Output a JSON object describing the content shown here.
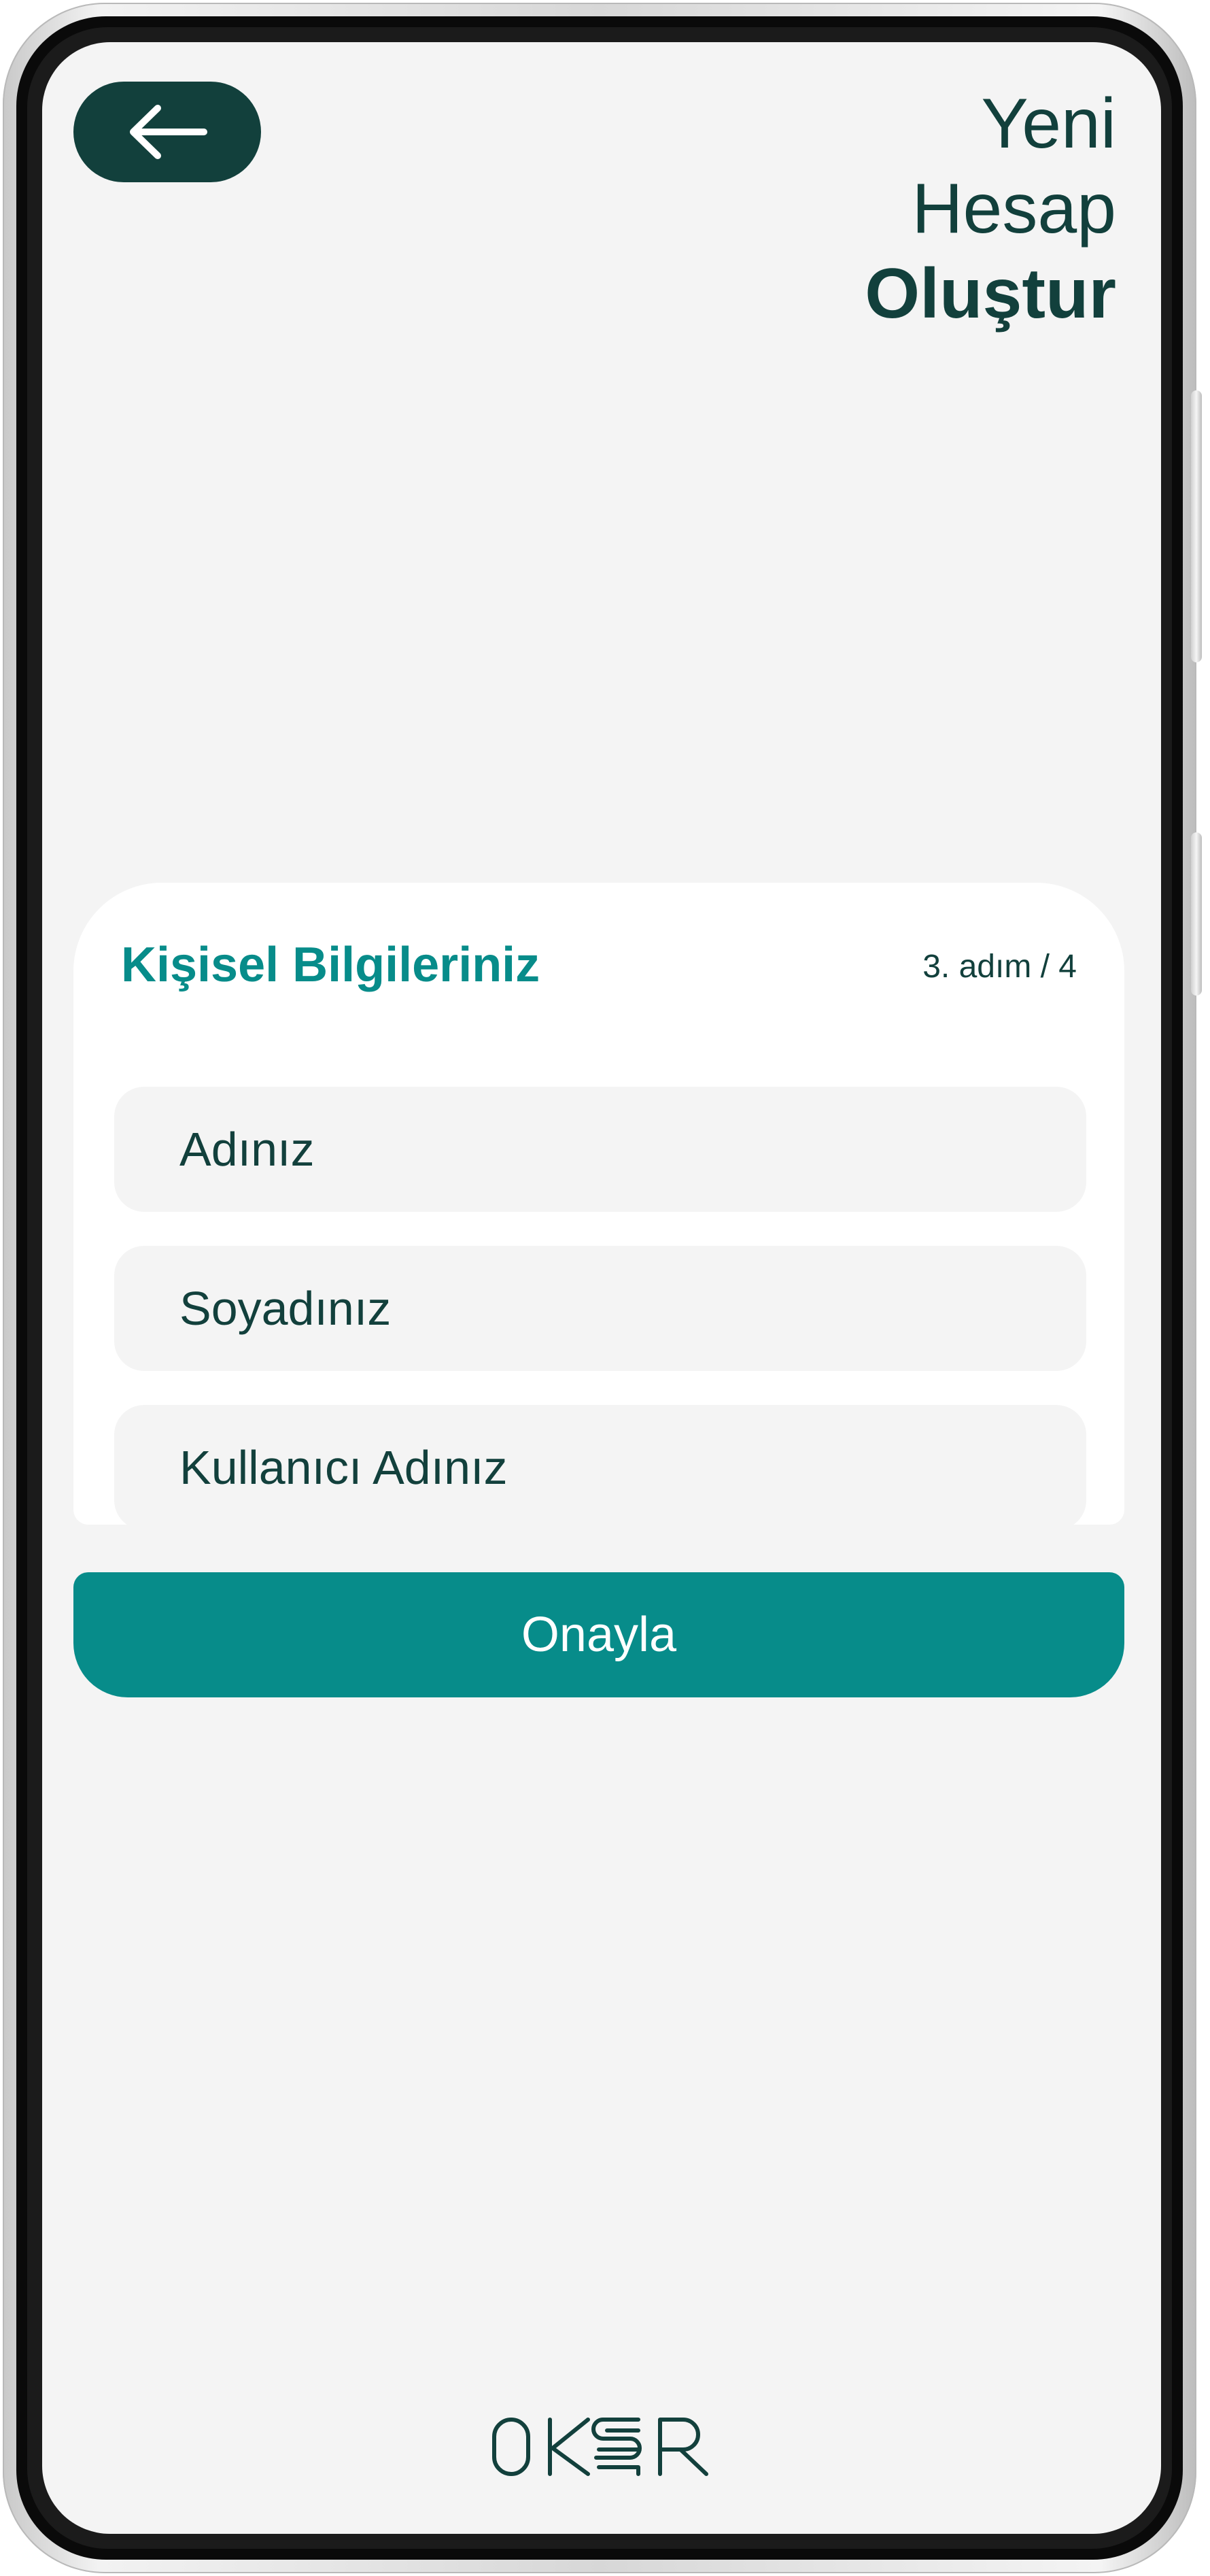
{
  "header": {
    "back_icon": "arrow-left-icon",
    "title_line1": "Yeni",
    "title_line2": "Hesap",
    "title_line3": "Oluştur"
  },
  "form": {
    "heading": "Kişisel Bilgileriniz",
    "step": "3. adım / 4",
    "fields": [
      {
        "placeholder": "Adınız",
        "value": ""
      },
      {
        "placeholder": "Soyadınız",
        "value": ""
      },
      {
        "placeholder": "Kullanıcı Adınız",
        "value": ""
      }
    ]
  },
  "actions": {
    "confirm_label": "Onayla"
  },
  "brand": {
    "logo_text": "OKSR",
    "logo_icon": "okur-logo"
  },
  "colors": {
    "screen_bg": "#f4f4f4",
    "dark_green": "#12403c",
    "teal": "#078c8a",
    "card_bg": "#ffffff"
  }
}
